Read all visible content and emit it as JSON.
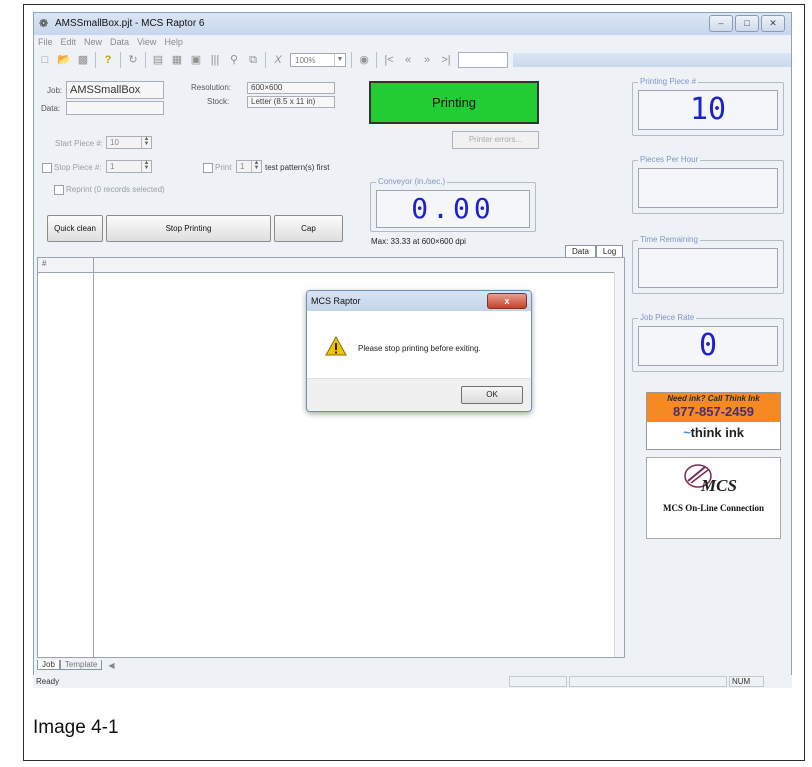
{
  "window": {
    "title": "AMSSmallBox.pjt - MCS Raptor 6",
    "controls": [
      "–",
      "□",
      "✕"
    ]
  },
  "menu": [
    "File",
    "Edit",
    "New",
    "Data",
    "View",
    "Help"
  ],
  "toolbar": {
    "zoom": "100%",
    "icons": [
      "new-icon",
      "open-icon",
      "save-icon",
      "help-icon",
      "refresh-icon",
      "list-icon",
      "image-icon",
      "picture-icon",
      "barcode-icon",
      "search-icon",
      "copy-icon",
      "cut-icon",
      "binoculars-icon",
      "first-icon",
      "prev-icon",
      "next-icon",
      "last-icon"
    ]
  },
  "job": {
    "job_label": "Job:",
    "job_value": "AMSSmallBox",
    "data_label": "Data:",
    "data_value": "",
    "resolution_label": "Resolution:",
    "resolution_value": "600×600",
    "stock_label": "Stock:",
    "stock_value": "Letter (8.5 x 11 in)",
    "start_piece_label": "Start Piece #:",
    "start_piece_value": "10",
    "stop_piece_label": "Stop Piece #:",
    "stop_piece_value": "1",
    "print_label": "Print",
    "print_value": "1",
    "test_pattern_label": "test pattern(s) first",
    "reprint_label": "Reprint (0 records selected)"
  },
  "buttons": {
    "quick_clean": "Quick clean",
    "stop_printing": "Stop Printing",
    "cap": "Cap",
    "printer_errors": "Printer errors..."
  },
  "status_display": "Printing",
  "conveyor": {
    "label": "Conveyor (in./sec.)",
    "value": "0.00",
    "max_text": "Max: 33.33 at 600×600 dpi"
  },
  "panels": {
    "printing_piece_label": "Printing Piece #",
    "printing_piece_value": "10",
    "pieces_per_hour_label": "Pieces Per Hour",
    "pieces_per_hour_value": "",
    "time_remaining_label": "Time Remaining",
    "time_remaining_value": "",
    "job_piece_rate_label": "Job Piece Rate",
    "job_piece_rate_value": "0"
  },
  "grid": {
    "col_header": "#"
  },
  "tabs": {
    "data": "Data",
    "log": "Log",
    "job": "Job",
    "template": "Template"
  },
  "statusbar": {
    "left": "Ready",
    "num": "NUM"
  },
  "dialog": {
    "title": "MCS Raptor",
    "close": "x",
    "message": "Please stop printing before exiting.",
    "ok": "OK"
  },
  "ads": {
    "think_ink_tagline": "Need ink? Call Think Ink",
    "think_ink_phone": "877-857-2459",
    "think_ink_logo": "think ink",
    "mcs_logo": "MCS",
    "mcs_tagline": "MCS On-Line Connection"
  },
  "caption": "Image 4-1",
  "colors": {
    "printing_green": "#22cc33",
    "lcd_blue": "#1d22c9",
    "think_ink_orange": "#f48a21"
  }
}
